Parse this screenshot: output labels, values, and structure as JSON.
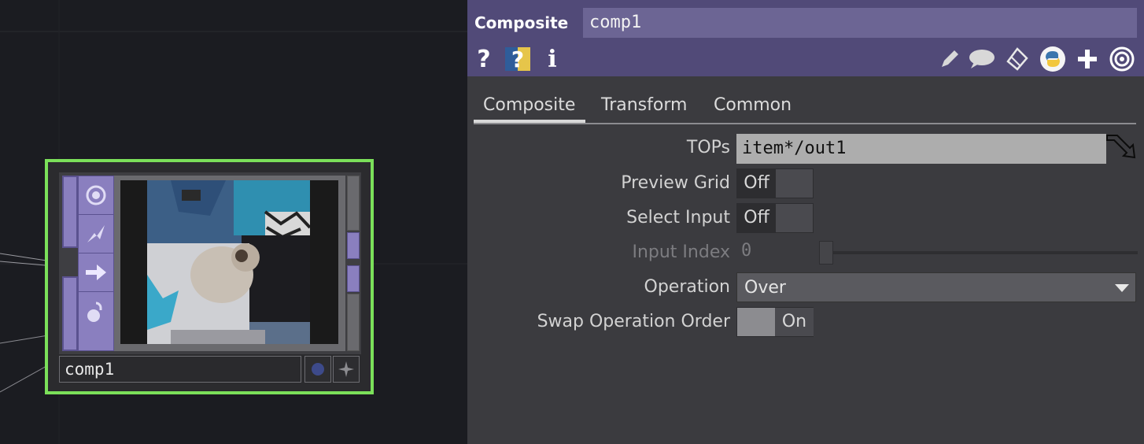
{
  "network": {
    "node": {
      "name": "comp1",
      "border_color": "#7be05a",
      "icons": [
        "viewer-active-icon",
        "cook-icon",
        "bypass-arrow-icon",
        "lock-icon"
      ],
      "flags": [
        "display-flag-icon",
        "render-flag-icon"
      ],
      "preview_image": "cat-photo"
    }
  },
  "panel": {
    "header": {
      "op_type": "Composite",
      "op_name": "comp1",
      "bg_color": "#514a78",
      "left_icons": [
        "help-icon",
        "python-help-icon",
        "info-icon"
      ],
      "right_icons": [
        "edit-icon",
        "comment-icon",
        "clone-icon",
        "python-icon",
        "add-icon",
        "viewer-icon"
      ]
    },
    "tabs": [
      {
        "label": "Composite",
        "active": true
      },
      {
        "label": "Transform",
        "active": false
      },
      {
        "label": "Common",
        "active": false
      }
    ],
    "params": {
      "tops": {
        "label": "TOPs",
        "value": "item*/out1"
      },
      "preview_grid": {
        "label": "Preview Grid",
        "state": "Off"
      },
      "select_input": {
        "label": "Select Input",
        "state": "Off"
      },
      "input_index": {
        "label": "Input Index",
        "value": "0",
        "enabled": false
      },
      "operation": {
        "label": "Operation",
        "value": "Over"
      },
      "swap_order": {
        "label": "Swap Operation Order",
        "state": "On"
      }
    }
  }
}
